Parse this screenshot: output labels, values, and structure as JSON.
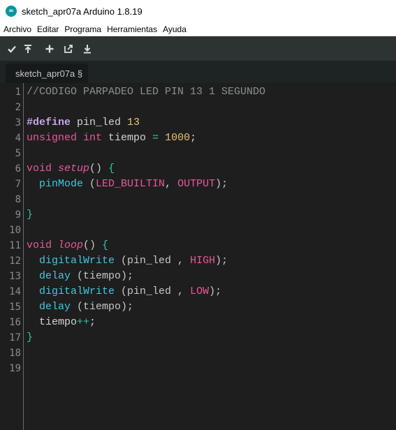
{
  "window": {
    "title": "sketch_apr07a Arduino 1.8.19"
  },
  "menu": [
    "Archivo",
    "Editar",
    "Programa",
    "Herramientas",
    "Ayuda"
  ],
  "toolbar": [
    {
      "name": "verify-button",
      "icon": "check-icon"
    },
    {
      "name": "upload-button",
      "icon": "upload-arrow-icon"
    },
    {
      "name": "new-button",
      "icon": "plus-icon"
    },
    {
      "name": "open-button",
      "icon": "open-icon"
    },
    {
      "name": "save-button",
      "icon": "save-down-arrow-icon"
    }
  ],
  "tabs": [
    {
      "label": "sketch_apr07a §"
    }
  ],
  "editor": {
    "line_numbers": [
      "1",
      "2",
      "3",
      "4",
      "5",
      "6",
      "7",
      "8",
      "9",
      "10",
      "11",
      "12",
      "13",
      "14",
      "15",
      "16",
      "17",
      "18",
      "19"
    ],
    "lines": [
      [
        {
          "t": "//CODIGO PARPADEO LED PIN 13 1 SEGUNDO",
          "c": "comment"
        }
      ],
      [],
      [
        {
          "t": "#define",
          "c": "pre"
        },
        {
          "t": " pin_led ",
          "c": "text"
        },
        {
          "t": "13",
          "c": "num"
        }
      ],
      [
        {
          "t": "unsigned",
          "c": "type"
        },
        {
          "t": " ",
          "c": "text"
        },
        {
          "t": "int",
          "c": "type"
        },
        {
          "t": " tiempo ",
          "c": "text"
        },
        {
          "t": "=",
          "c": "op"
        },
        {
          "t": " ",
          "c": "text"
        },
        {
          "t": "1000",
          "c": "num"
        },
        {
          "t": ";",
          "c": "text"
        }
      ],
      [],
      [
        {
          "t": "void",
          "c": "type"
        },
        {
          "t": " ",
          "c": "text"
        },
        {
          "t": "setup",
          "c": "fn"
        },
        {
          "t": "() ",
          "c": "paren"
        },
        {
          "t": "{",
          "c": "brace"
        }
      ],
      [
        {
          "t": "  ",
          "c": "text"
        },
        {
          "t": "pinMode",
          "c": "call"
        },
        {
          "t": " (",
          "c": "paren"
        },
        {
          "t": "LED_BUILTIN",
          "c": "const"
        },
        {
          "t": ", ",
          "c": "text"
        },
        {
          "t": "OUTPUT",
          "c": "const"
        },
        {
          "t": ");",
          "c": "paren"
        }
      ],
      [],
      [
        {
          "t": "}",
          "c": "brace"
        }
      ],
      [],
      [
        {
          "t": "void",
          "c": "type"
        },
        {
          "t": " ",
          "c": "text"
        },
        {
          "t": "loop",
          "c": "fn"
        },
        {
          "t": "() ",
          "c": "paren"
        },
        {
          "t": "{",
          "c": "brace"
        }
      ],
      [
        {
          "t": "  ",
          "c": "text"
        },
        {
          "t": "digitalWrite",
          "c": "call"
        },
        {
          "t": " (pin_led , ",
          "c": "paren"
        },
        {
          "t": "HIGH",
          "c": "const"
        },
        {
          "t": ");",
          "c": "paren"
        }
      ],
      [
        {
          "t": "  ",
          "c": "text"
        },
        {
          "t": "delay",
          "c": "call"
        },
        {
          "t": " (tiempo);",
          "c": "paren"
        }
      ],
      [
        {
          "t": "  ",
          "c": "text"
        },
        {
          "t": "digitalWrite",
          "c": "call"
        },
        {
          "t": " (pin_led , ",
          "c": "paren"
        },
        {
          "t": "LOW",
          "c": "const"
        },
        {
          "t": ");",
          "c": "paren"
        }
      ],
      [
        {
          "t": "  ",
          "c": "text"
        },
        {
          "t": "delay",
          "c": "call"
        },
        {
          "t": " (tiempo);",
          "c": "paren"
        }
      ],
      [
        {
          "t": "  tiempo",
          "c": "text"
        },
        {
          "t": "++",
          "c": "op"
        },
        {
          "t": ";",
          "c": "text"
        }
      ],
      [
        {
          "t": "}",
          "c": "brace"
        }
      ],
      [],
      []
    ]
  },
  "colors": {
    "toolbar_bg": "#2d3232",
    "editor_bg": "#1e1e1e",
    "comment": "#8c9090",
    "keyword_type": "#e8589a",
    "number": "#e8c46c",
    "function_call": "#40c8e0",
    "brace": "#2fc6a6"
  }
}
